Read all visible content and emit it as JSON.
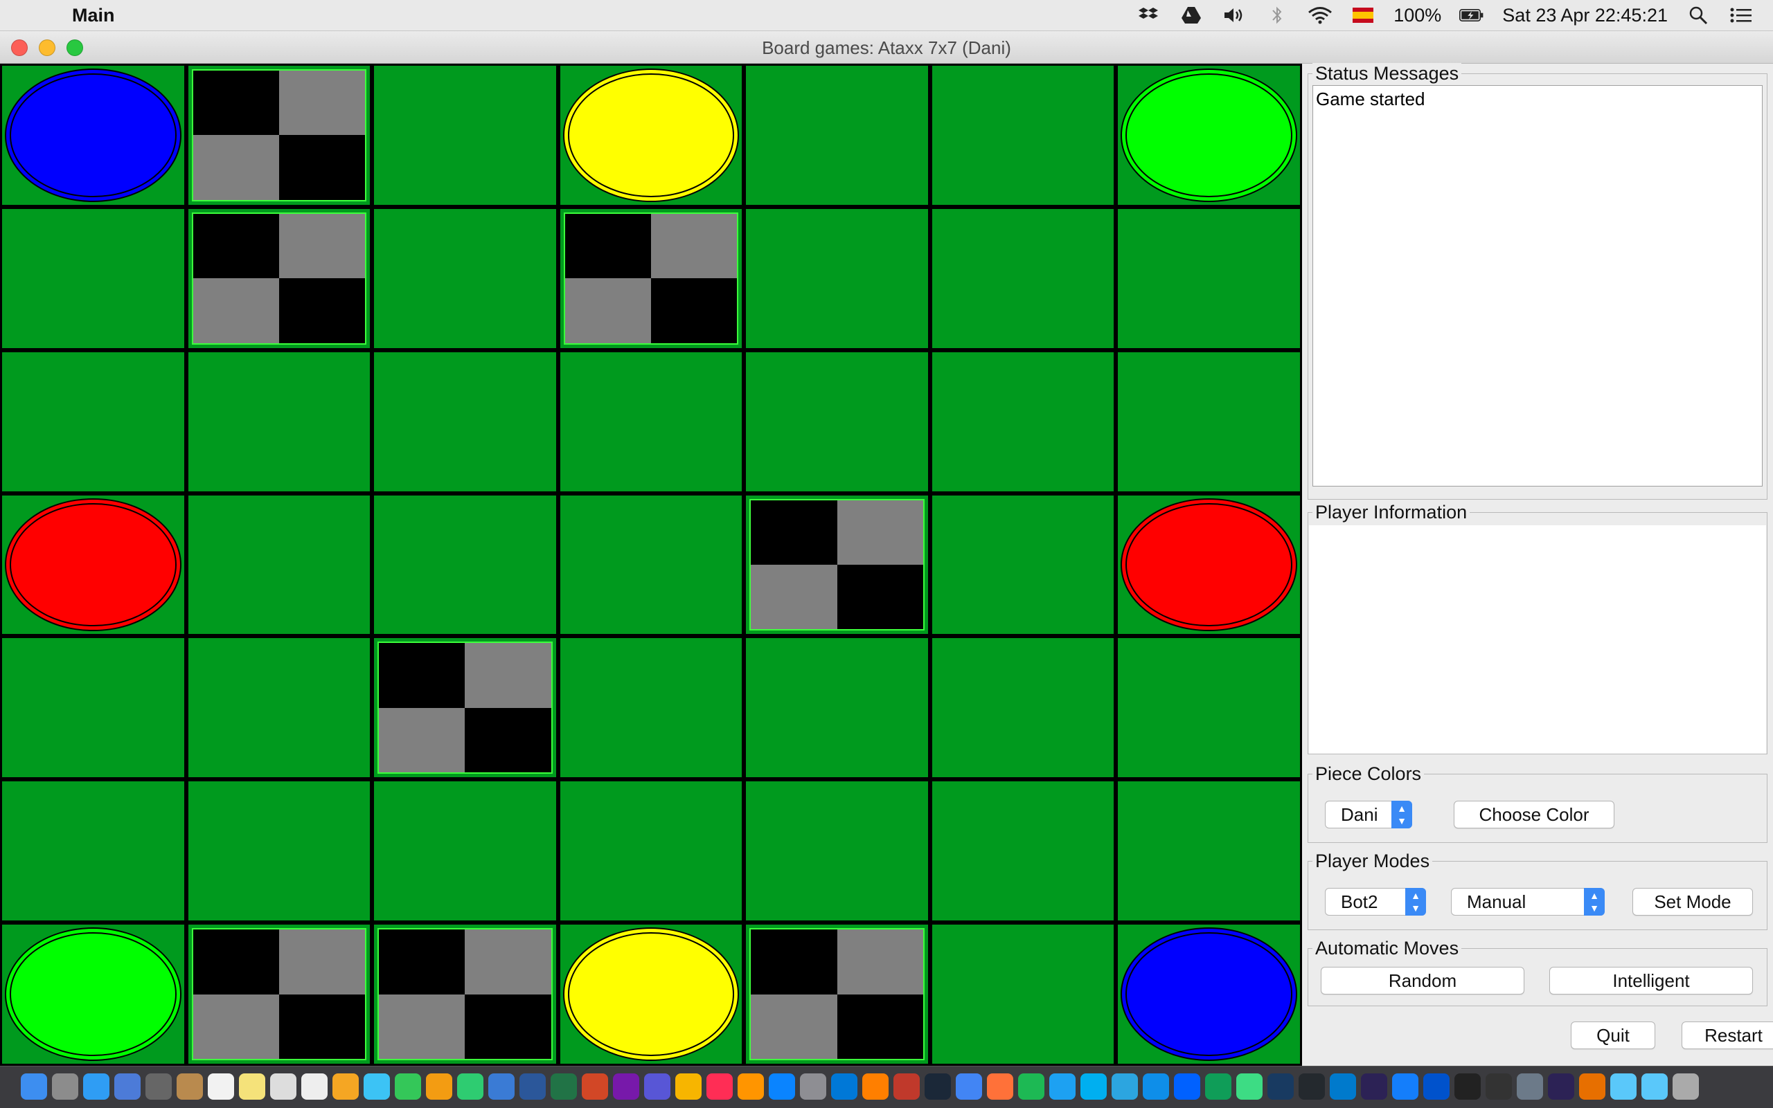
{
  "menubar": {
    "apple_glyph": "",
    "app_name": "Main",
    "battery": "100%",
    "datetime": "Sat 23 Apr  22:45:21",
    "icons": [
      "dropbox-icon",
      "google-drive-icon",
      "volume-icon",
      "bluetooth-icon",
      "wifi-icon",
      "keyboard-flag-icon",
      "battery-icon",
      "spotlight-icon",
      "notification-center-icon"
    ]
  },
  "window": {
    "title": "Board games: Ataxx 7x7 (Dani)"
  },
  "board": {
    "rows": 7,
    "cols": 7,
    "grid": [
      [
        "blue",
        "obstacle",
        "empty",
        "yellow",
        "empty",
        "empty",
        "green"
      ],
      [
        "empty",
        "obstacle",
        "empty",
        "obstacle",
        "empty",
        "empty",
        "empty"
      ],
      [
        "empty",
        "empty",
        "empty",
        "empty",
        "empty",
        "empty",
        "empty"
      ],
      [
        "red",
        "empty",
        "empty",
        "empty",
        "obstacle",
        "empty",
        "red"
      ],
      [
        "empty",
        "empty",
        "obstacle",
        "empty",
        "empty",
        "empty",
        "empty"
      ],
      [
        "empty",
        "empty",
        "empty",
        "empty",
        "empty",
        "empty",
        "empty"
      ],
      [
        "green",
        "obstacle",
        "obstacle",
        "yellow",
        "obstacle",
        "empty",
        "blue"
      ]
    ],
    "colors": {
      "cell": "#009a1e",
      "blue": "#0000ff",
      "yellow": "#ffff00",
      "green": "#00ff00",
      "red": "#ff0000"
    }
  },
  "panel": {
    "status": {
      "title": "Status Messages",
      "text": "Game started"
    },
    "player_info": {
      "title": "Player Information"
    },
    "piece_colors": {
      "title": "Piece Colors",
      "player_select": "Dani",
      "choose_color": "Choose Color"
    },
    "player_modes": {
      "title": "Player Modes",
      "player_select": "Bot2",
      "mode_select": "Manual",
      "set_mode": "Set Mode"
    },
    "auto_moves": {
      "title": "Automatic Moves",
      "random": "Random",
      "intelligent": "Intelligent"
    },
    "quit": "Quit",
    "restart": "Restart"
  },
  "dock": {
    "items": [
      "finder",
      "launchpad",
      "safari",
      "preview",
      "automator",
      "contacts",
      "calendar",
      "notes",
      "reminders",
      "textedit",
      "photos",
      "messages",
      "facetime",
      "pages",
      "numbers",
      "keynote",
      "word",
      "excel",
      "powerpoint",
      "onenote",
      "imovie",
      "sketch",
      "itunes",
      "ibooks",
      "app-store",
      "system-preferences",
      "edge",
      "vlc",
      "popcorn",
      "steam",
      "chrome",
      "firefox",
      "spotify",
      "twitter",
      "skype",
      "telegram",
      "teamviewer",
      "dropbox",
      "google-drive",
      "android-studio",
      "virtualbox",
      "github",
      "vscode",
      "eclipse",
      "xcode",
      "sourcetree",
      "terminal",
      "activity-monitor",
      "image-capture",
      "eclipse2",
      "java",
      "folder",
      "folder2",
      "trash"
    ]
  }
}
